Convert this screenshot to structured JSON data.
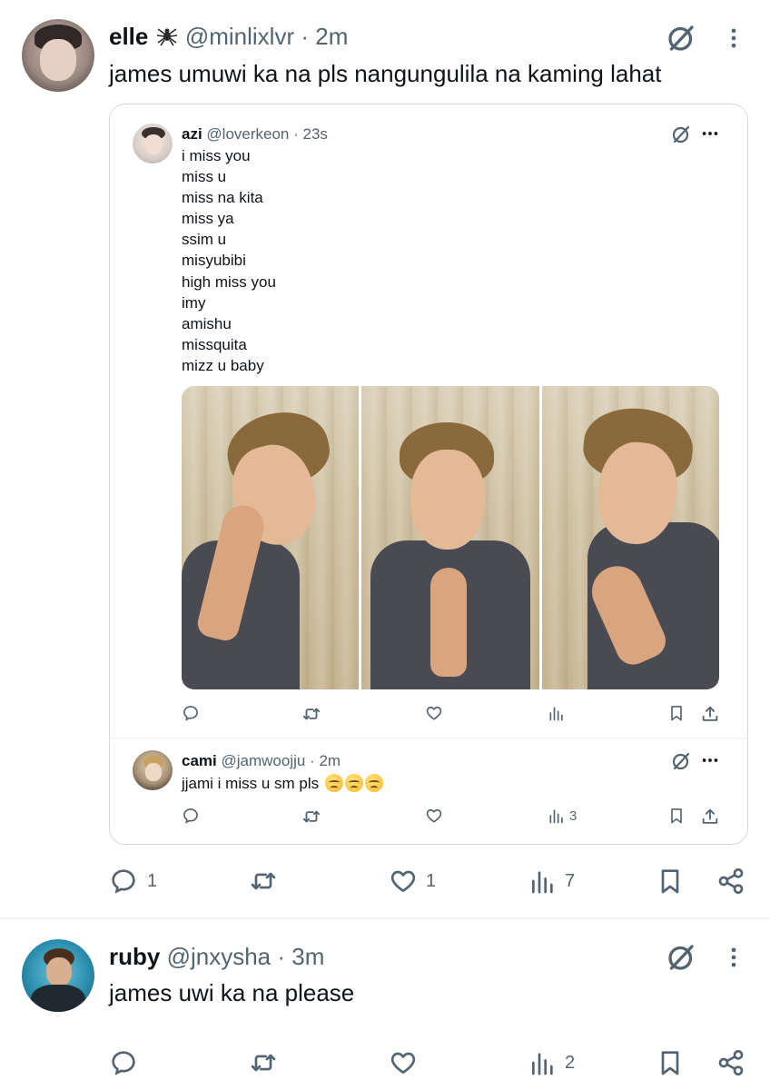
{
  "tweet1": {
    "name": "elle",
    "handle": "@minlixlvr",
    "time": "· 2m",
    "text": "james umuwi ka na pls nangungulila na kaming lahat",
    "replies": "1",
    "likes": "1",
    "views": "7"
  },
  "quote1": {
    "name": "azi",
    "handle": "@loverkeon",
    "time": "· 23s",
    "lines": [
      "i miss you",
      "miss u",
      "miss na kita",
      "miss ya",
      "ssim u",
      "misyubibi",
      "high miss you",
      "imy",
      "amishu",
      "missquita",
      "mizz u baby"
    ]
  },
  "quote2": {
    "name": "cami",
    "handle": "@jamwoojju",
    "time": "· 2m",
    "text": "jjami i miss u sm pls",
    "views": "3"
  },
  "tweet2": {
    "name": "ruby",
    "handle": "@jnxysha",
    "time": "· 3m",
    "text": "james uwi ka na please",
    "views": "2"
  },
  "icons": {
    "reply": "reply-icon",
    "retweet": "retweet-icon",
    "like": "heart-icon",
    "views": "views-icon",
    "bookmark": "bookmark-icon",
    "share": "share-icon",
    "grok": "grok-icon",
    "more": "more-icon"
  },
  "colors": {
    "text": "#0f1419",
    "secondary": "#536471",
    "border": "#cfd9de"
  }
}
